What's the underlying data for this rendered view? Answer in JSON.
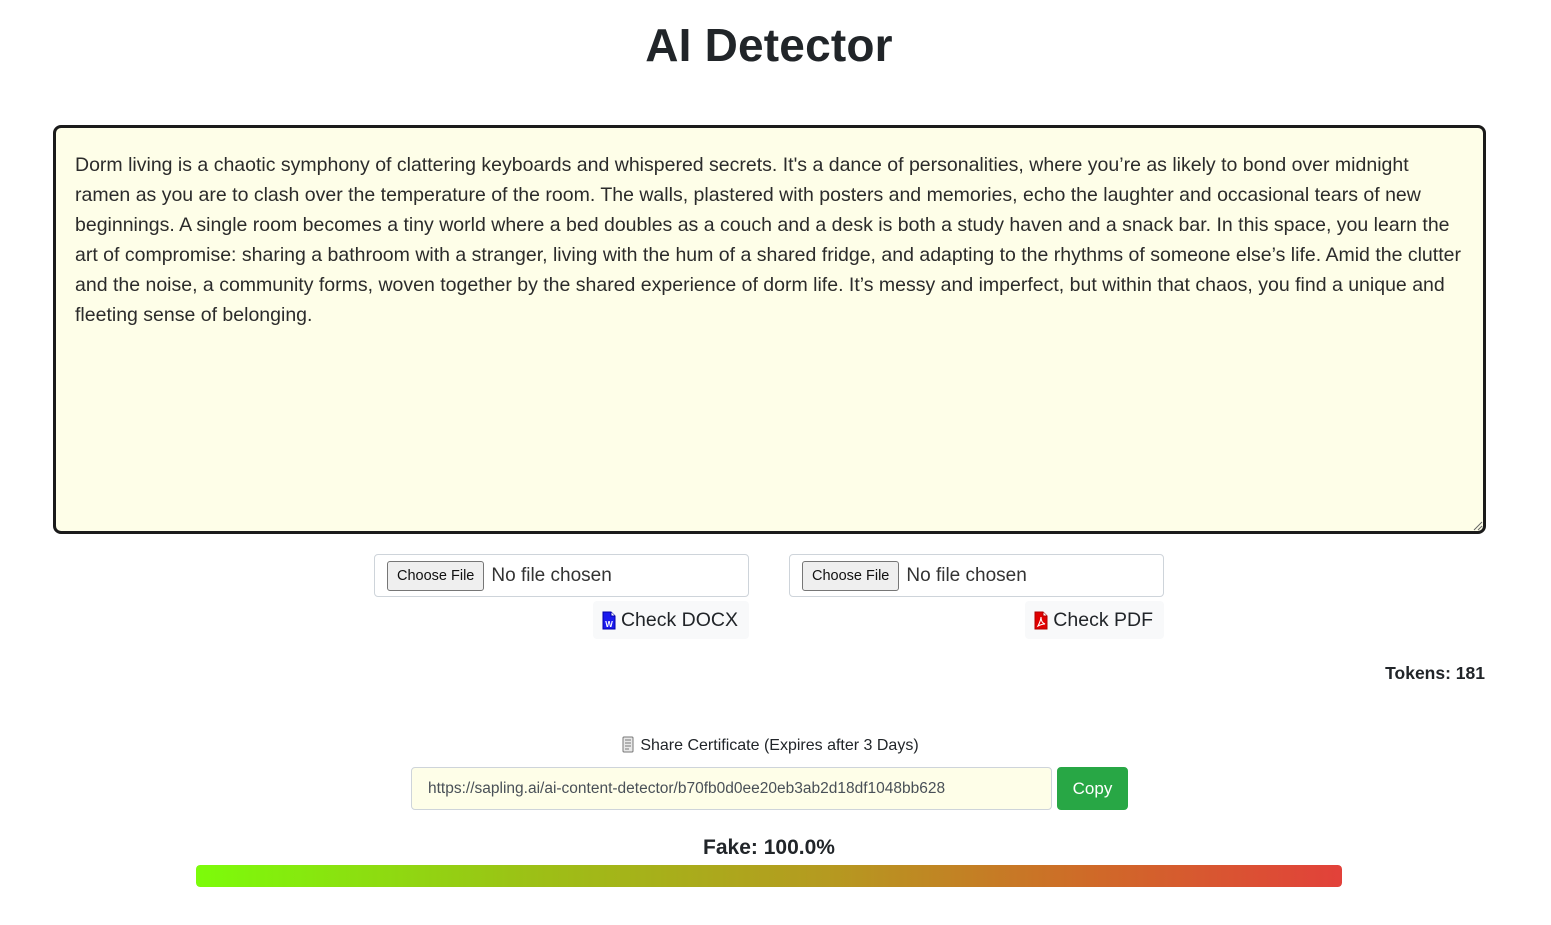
{
  "page": {
    "title": "AI Detector"
  },
  "editor": {
    "text": "Dorm living is a chaotic symphony of clattering keyboards and whispered secrets. It's a dance of personalities, where you’re as likely to bond over midnight ramen as you are to clash over the temperature of the room. The walls, plastered with posters and memories, echo the laughter and occasional tears of new beginnings. A single room becomes a tiny world where a bed doubles as a couch and a desk is both a study haven and a snack bar. In this space, you learn the art of compromise: sharing a bathroom with a stranger, living with the hum of a shared fridge, and adapting to the rhythms of someone else’s life. Amid the clutter and the noise, a community forms, woven together by the shared experience of dorm life. It’s messy and imperfect, but within that chaos, you find a unique and fleeting sense of belonging."
  },
  "uploads": {
    "docx": {
      "choose_label": "Choose File",
      "status": "No file chosen",
      "check_label": "Check DOCX",
      "icon": "word-file-icon",
      "icon_color": "#0000ee"
    },
    "pdf": {
      "choose_label": "Choose File",
      "status": "No file chosen",
      "check_label": "Check PDF",
      "icon": "pdf-file-icon",
      "icon_color": "#e00000"
    }
  },
  "tokens": {
    "label": "Tokens: 181"
  },
  "share": {
    "icon": "certificate-icon",
    "label": "Share Certificate (Expires after 3 Days)",
    "url": "https://sapling.ai/ai-content-detector/b70fb0d0ee20eb3ab2d18df1048bb628",
    "copy_label": "Copy"
  },
  "result": {
    "label": "Fake: 100.0%",
    "fake_percent": 100.0
  },
  "colors": {
    "editor_background": "#fefee8",
    "copy_button": "#28a745",
    "bar_start": "#7cfc0a",
    "bar_end": "#e2413a"
  }
}
